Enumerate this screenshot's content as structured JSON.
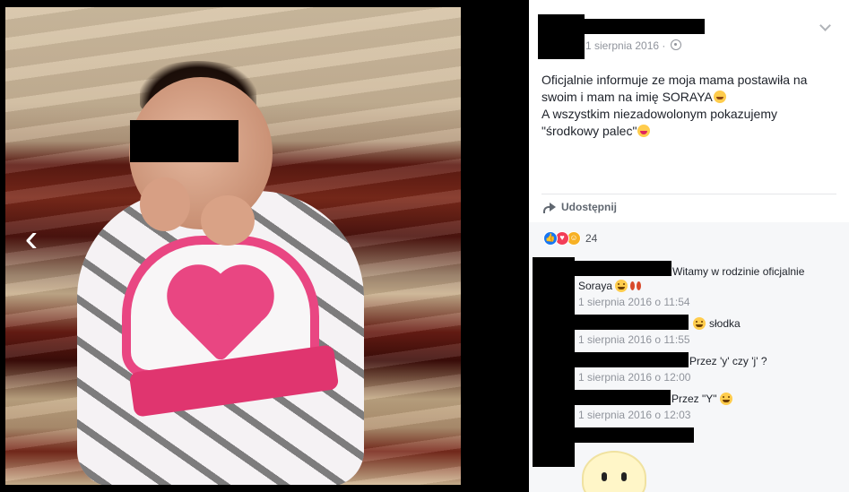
{
  "post": {
    "date": "1 sierpnia 2016 ·",
    "text_lines": [
      "Oficjalnie informuje ze moja mama postawiła na",
      "swoim i mam na imię SORAYA",
      "A wszystkim niezadowolonym pokazujemy",
      "\"środkowy palec\""
    ],
    "icons": {
      "audience": "globe-icon",
      "options": "chevron-down-icon"
    }
  },
  "actions": {
    "share_label": "Udostępnij"
  },
  "reactions": {
    "count": "24",
    "types": [
      "like",
      "love",
      "haha"
    ]
  },
  "comments": [
    {
      "text": "Witamy w rodzinie oficjalnie",
      "text2": "Soraya",
      "time": "1 sierpnia 2016 o 11:54"
    },
    {
      "text": "słodka",
      "time": "1 sierpnia 2016 o 11:55"
    },
    {
      "text": "Przez 'y' czy 'j' ?",
      "time": "1 sierpnia 2016 o 12:00"
    },
    {
      "text": "Przez \"Y\"",
      "time": "1 sierpnia 2016 o 12:03"
    }
  ],
  "colors": {
    "accent": "#1877f2",
    "text": "#1d2129",
    "meta": "#90949c",
    "censor": "#000000"
  }
}
